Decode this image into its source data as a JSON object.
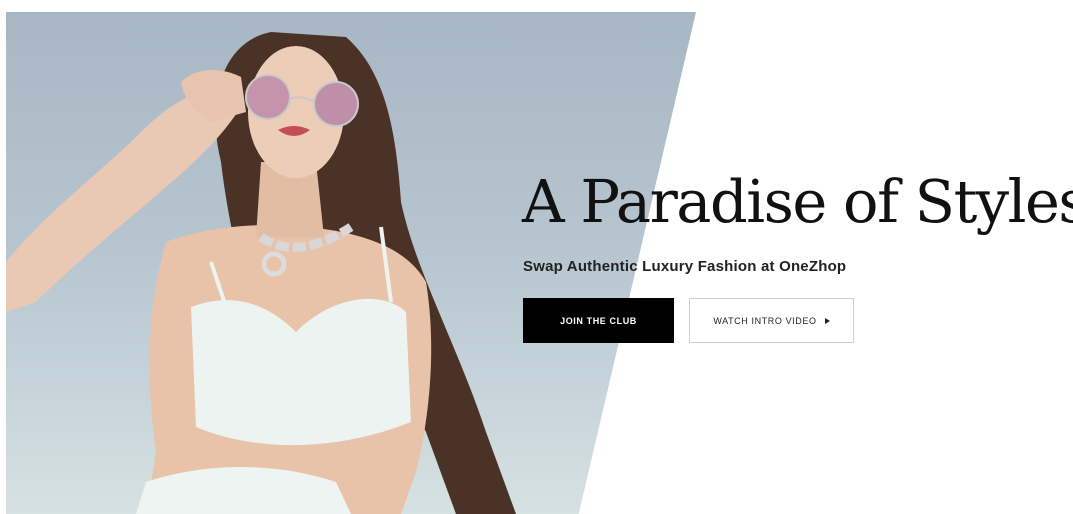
{
  "hero": {
    "headline": "A Paradise of Styles",
    "subheadline": "Swap Authentic Luxury Fashion at OneZhop",
    "primary_button_label": "JOIN THE CLUB",
    "secondary_button_label": "WATCH INTRO VIDEO",
    "secondary_button_icon": "play-icon",
    "photo_alt": "Model wearing round pink sunglasses, a chunky silver chain necklace and a white crop top"
  },
  "colors": {
    "text": "#111111",
    "primary_button_bg": "#000000",
    "primary_button_text": "#ffffff",
    "secondary_button_border": "#cfcfcf",
    "photo_sky": "#b6c4cf"
  }
}
